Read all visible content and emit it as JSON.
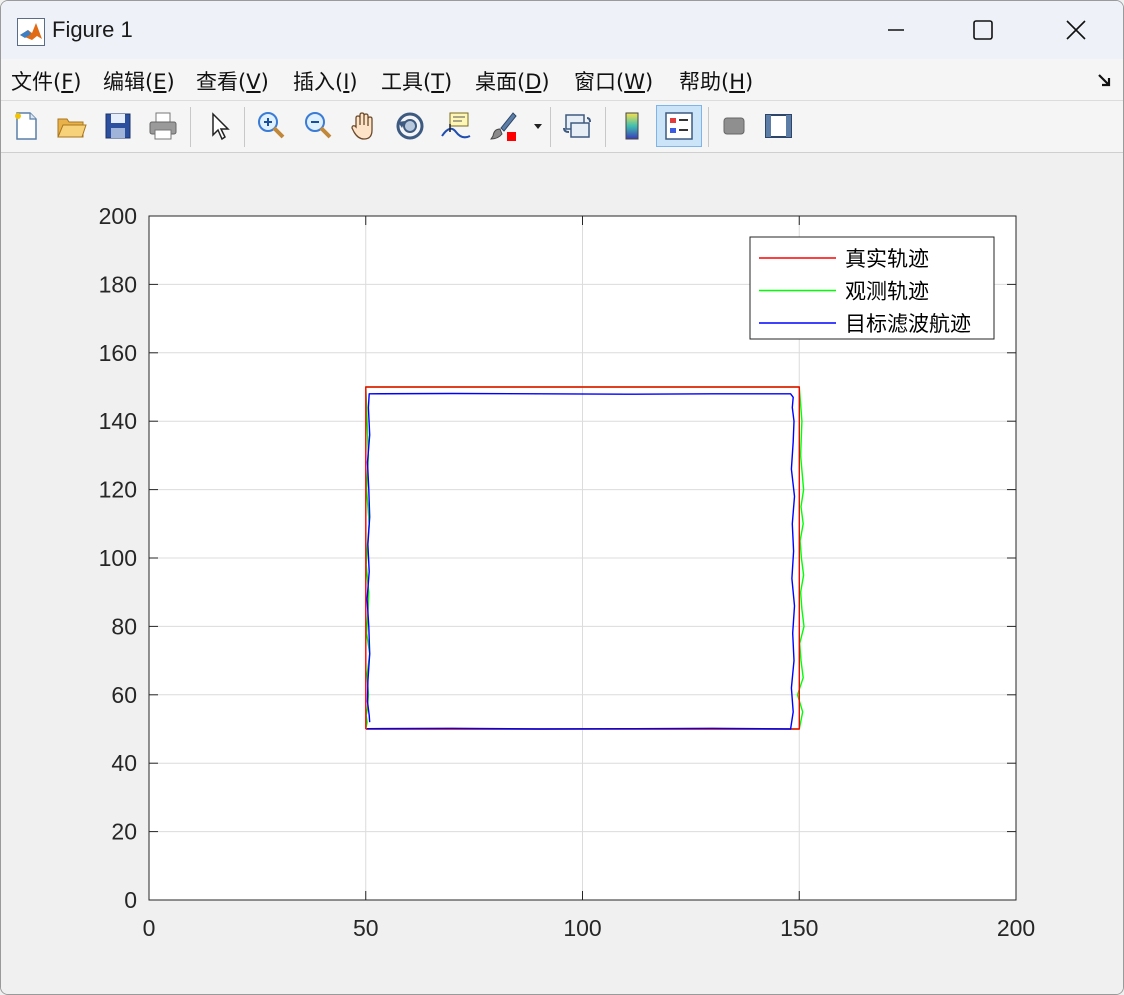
{
  "window": {
    "title": "Figure 1"
  },
  "menu": [
    {
      "label": "文件(",
      "key": "F",
      "end": ")"
    },
    {
      "label": "编辑(",
      "key": "E",
      "end": ")"
    },
    {
      "label": "查看(",
      "key": "V",
      "end": ")"
    },
    {
      "label": "插入(",
      "key": "I",
      "end": ")"
    },
    {
      "label": "工具(",
      "key": "T",
      "end": ")"
    },
    {
      "label": "桌面(",
      "key": "D",
      "end": ")"
    },
    {
      "label": "窗口(",
      "key": "W",
      "end": ")"
    },
    {
      "label": "帮助(",
      "key": "H",
      "end": ")"
    }
  ],
  "toolbar": {
    "icons": [
      "new-figure-icon",
      "open-file-icon",
      "save-icon",
      "print-icon",
      "pointer-icon",
      "zoom-in-icon",
      "zoom-out-icon",
      "pan-hand-icon",
      "rotate-3d-icon",
      "data-cursor-icon",
      "brush-icon",
      "link-plot-icon",
      "colorbar-icon",
      "legend-icon",
      "hide-plot-tools-icon",
      "show-plot-tools-icon"
    ],
    "active": "legend-icon"
  },
  "colors": {
    "true_track": "#ff0000",
    "observed_track": "#00ff00",
    "filtered_track": "#0000ff"
  },
  "chart_data": {
    "type": "line",
    "title": "",
    "xlabel": "",
    "ylabel": "",
    "xlim": [
      0,
      200
    ],
    "ylim": [
      0,
      200
    ],
    "xticks": [
      0,
      50,
      100,
      150,
      200
    ],
    "yticks": [
      0,
      20,
      40,
      60,
      80,
      100,
      120,
      140,
      160,
      180,
      200
    ],
    "grid": true,
    "legend_position": "top-right",
    "series": [
      {
        "name": "真实轨迹",
        "color": "#ff0000",
        "x": [
          50,
          150,
          150,
          50,
          50
        ],
        "y": [
          50,
          50,
          150,
          150,
          50
        ]
      },
      {
        "name": "观测轨迹",
        "color": "#00ff00",
        "x": [
          50,
          150,
          150.8,
          149.6,
          150.9,
          150.4,
          150.1,
          151.1,
          150.6,
          150.3,
          151.0,
          150.5,
          150.2,
          150.9,
          150.4,
          151.0,
          150.3,
          150.6,
          150,
          50,
          50.3,
          50.6,
          50.2,
          50.8,
          50.4,
          50.1,
          50.7,
          50.5,
          50.2,
          50.9,
          50.3,
          50.6,
          50.4,
          50.1,
          50.3,
          50
        ],
        "y": [
          50,
          50,
          55,
          60,
          65,
          70,
          75,
          80,
          85,
          90,
          95,
          100,
          105,
          110,
          115,
          120,
          130,
          140,
          150,
          150,
          140,
          130,
          120,
          110,
          104,
          98,
          90,
          84,
          78,
          72,
          66,
          60,
          56,
          54,
          52,
          50
        ]
      },
      {
        "name": "目标滤波航迹",
        "color": "#0000ff",
        "x": [
          50.3,
          70,
          90,
          110,
          130,
          148,
          148.6,
          148.2,
          148.8,
          148.5,
          148.9,
          148.3,
          148.7,
          148.4,
          148.9,
          148.2,
          148.6,
          148.8,
          148.4,
          148.6,
          148,
          130,
          110,
          90,
          70,
          50.8,
          50.6,
          50.9,
          50.4,
          50.7,
          50.9,
          50.5,
          50.8,
          50.3,
          50.7,
          50.9,
          50.5,
          50.4,
          50.8,
          50.9
        ],
        "y": [
          50.1,
          50.2,
          50,
          50.1,
          50.2,
          50,
          55,
          62,
          70,
          78,
          86,
          94,
          102,
          110,
          118,
          126,
          134,
          140,
          144,
          147,
          148,
          148,
          147.9,
          148,
          148.1,
          148,
          144,
          136,
          128,
          120,
          112,
          104,
          96,
          88,
          80,
          72,
          64,
          58,
          54,
          52
        ]
      }
    ]
  }
}
